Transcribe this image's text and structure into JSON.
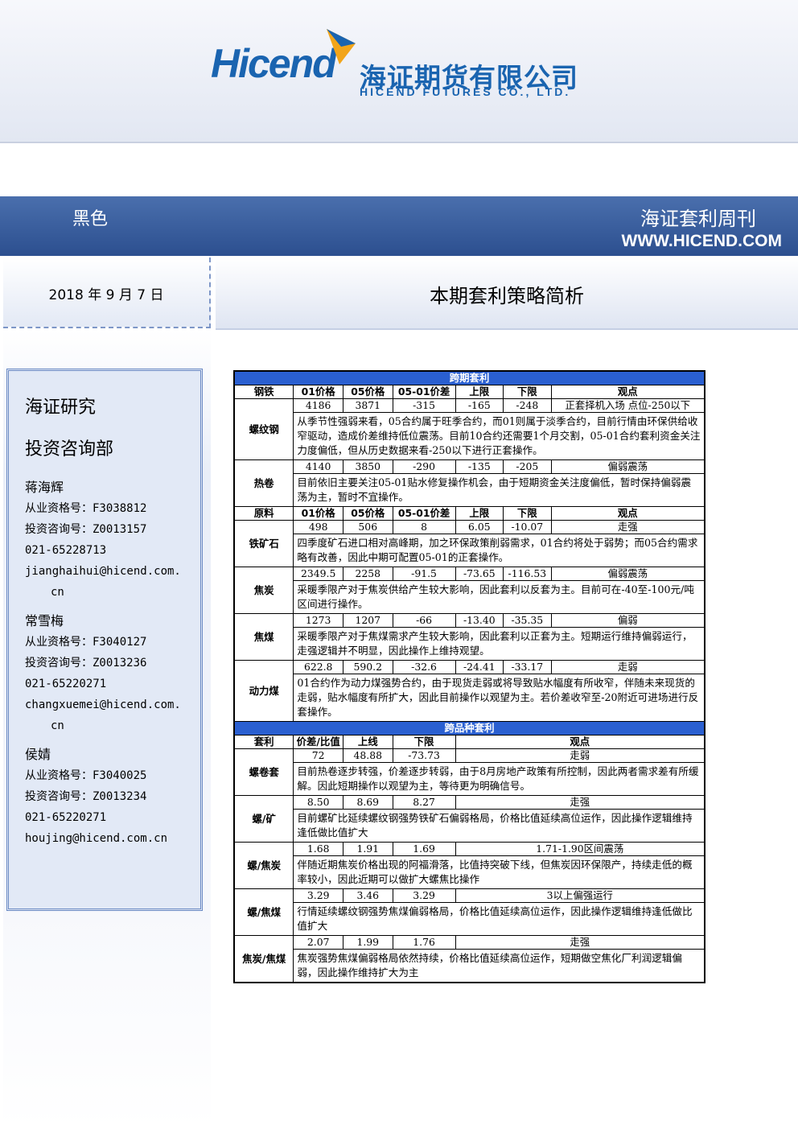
{
  "header": {
    "logo_en": "Hicend",
    "logo_cn": "海证期货有限公司",
    "logo_sub": "HICEND FUTURES CO., LTD."
  },
  "banner": {
    "category": "黑色",
    "publication": "海证套利周刊",
    "url": "WWW.HICEND.COM"
  },
  "date": "2018 年 9 月 7 日",
  "section_title": "本期套利策略简析",
  "sidebar": {
    "org": "海证研究",
    "dept": "投资咨询部",
    "people": [
      {
        "name": "蒋海辉",
        "license": "从业资格号：F3038812",
        "advisory": "投资咨询号：Z0013157",
        "phone": "021-65228713",
        "email1": "jianghaihui@hicend.com.",
        "email2": "cn"
      },
      {
        "name": "常雪梅",
        "license": "从业资格号：F3040127",
        "advisory": "投资咨询号：Z0013236",
        "phone": "021-65220271",
        "email1": "changxuemei@hicend.com.",
        "email2": "cn"
      },
      {
        "name": "侯婧",
        "license": "从业资格号：F3040025",
        "advisory": "投资咨询号：Z0013234",
        "phone": "021-65220271",
        "email1": "houjing@hicend.com.cn",
        "email2": ""
      }
    ]
  },
  "table": {
    "sec1": "跨期套利",
    "head1": [
      "钢铁",
      "01价格",
      "05价格",
      "05-01价差",
      "上限",
      "下限",
      "观点"
    ],
    "steel": [
      {
        "name": "螺纹钢",
        "vals": [
          "4186",
          "3871",
          "-315",
          "-165",
          "-248",
          "正套择机入场 点位-250以下"
        ],
        "comment": "从季节性强弱来看，05合约属于旺季合约，而01则属于淡季合约，目前行情由环保供给收窄驱动，造成价差维持低位震荡。目前10合约还需要1个月交割，05-01合约套利资金关注力度偏低，但从历史数据来看-250以下进行正套操作。"
      },
      {
        "name": "热卷",
        "vals": [
          "4140",
          "3850",
          "-290",
          "-135",
          "-205",
          "偏弱震荡"
        ],
        "comment": "目前依旧主要关注05-01贴水修复操作机会，由于短期资金关注度偏低，暂时保持偏弱震荡为主，暂时不宜操作。"
      }
    ],
    "head2": [
      "原料",
      "01价格",
      "05价格",
      "05-01价差",
      "上限",
      "下限",
      "观点"
    ],
    "raw": [
      {
        "name": "铁矿石",
        "vals": [
          "498",
          "506",
          "8",
          "6.05",
          "-10.07",
          "走强"
        ],
        "comment": "四季度矿石进口相对高峰期，加之环保政策削弱需求，01合约将处于弱势；而05合约需求略有改善，因此中期可配置05-01的正套操作。"
      },
      {
        "name": "焦炭",
        "vals": [
          "2349.5",
          "2258",
          "-91.5",
          "-73.65",
          "-116.53",
          "偏弱震荡"
        ],
        "comment": "采暖季限产对于焦炭供给产生较大影响，因此套利以反套为主。目前可在-40至-100元/吨区间进行操作。"
      },
      {
        "name": "焦煤",
        "vals": [
          "1273",
          "1207",
          "-66",
          "-13.40",
          "-35.35",
          "偏弱"
        ],
        "comment": "采暖季限产对于焦煤需求产生较大影响，因此套利以正套为主。短期运行维持偏弱运行，走强逻辑并不明显，因此操作上维持观望。"
      },
      {
        "name": "动力煤",
        "vals": [
          "622.8",
          "590.2",
          "-32.6",
          "-24.41",
          "-33.17",
          "走弱"
        ],
        "comment": "01合约作为动力煤强势合约，由于现货走弱或将导致贴水幅度有所收窄，伴随未来现货的走弱，贴水幅度有所扩大，因此目前操作以观望为主。若价差收窄至-20附近可进场进行反套操作。"
      }
    ],
    "sec2": "跨品种套利",
    "head3": [
      "套利",
      "价差/比值",
      "上线",
      "下限",
      "观点"
    ],
    "cross": [
      {
        "name": "螺卷套",
        "vals": [
          "72",
          "48.88",
          "-73.73",
          "走弱"
        ],
        "comment": "目前热卷逐步转强，价差逐步转弱，由于8月房地产政策有所控制，因此两者需求差有所缓解。因此短期操作以观望为主，等待更为明确信号。"
      },
      {
        "name": "螺/矿",
        "vals": [
          "8.50",
          "8.69",
          "8.27",
          "走强"
        ],
        "comment": "目前螺矿比延续螺纹钢强势铁矿石偏弱格局，价格比值延续高位运作，因此操作逻辑维持逢低做比值扩大"
      },
      {
        "name": "螺/焦炭",
        "vals": [
          "1.68",
          "1.91",
          "1.69",
          "1.71-1.90区间震荡"
        ],
        "comment": "伴随近期焦炭价格出现的阿福滑落，比值持突破下线，但焦炭因环保限产，持续走低的概率较小，因此近期可以做扩大螺焦比操作"
      },
      {
        "name": "螺/焦煤",
        "vals": [
          "3.29",
          "3.46",
          "3.29",
          "3以上偏强运行"
        ],
        "comment": "行情延续螺纹钢强势焦煤偏弱格局，价格比值延续高位运作，因此操作逻辑维持逢低做比值扩大"
      },
      {
        "name": "焦炭/焦煤",
        "vals": [
          "2.07",
          "1.99",
          "1.76",
          "走强"
        ],
        "comment": "焦炭强势焦煤偏弱格局依然持续，价格比值延续高位运作，短期做空焦化厂利润逻辑偏弱，因此操作维持扩大为主"
      }
    ]
  },
  "colors": {
    "brand": "#1a64b0",
    "band": "#2c4f8f",
    "table_header": "#2a5fd0"
  }
}
